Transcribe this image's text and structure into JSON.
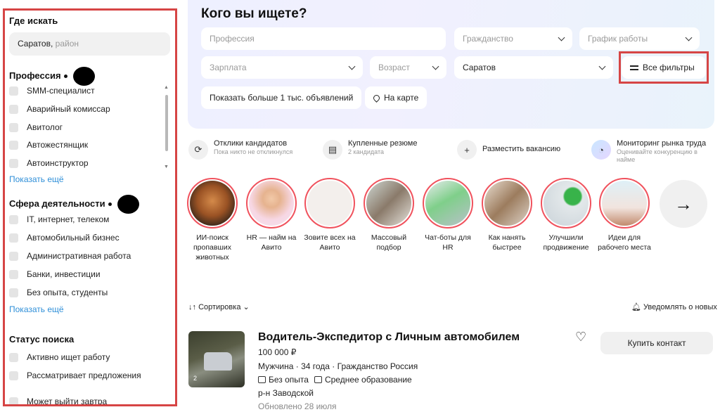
{
  "sidebar": {
    "where_heading": "Где искать",
    "location_value": "Саратов,",
    "location_placeholder": " район",
    "profession_heading": "Профессия",
    "professions": [
      "SMM-специалист",
      "Аварийный комиссар",
      "Авитолог",
      "Автожестянщик",
      "Автоинструктор"
    ],
    "show_more_1": "Показать ещё",
    "sphere_heading": "Сфера деятельности",
    "spheres": [
      "IT, интернет, телеком",
      "Автомобильный бизнес",
      "Административная работа",
      "Банки, инвестиции",
      "Без опыта, студенты"
    ],
    "show_more_2": "Показать ещё",
    "status_heading": "Статус поиска",
    "statuses": [
      "Активно ищет работу",
      "Рассматривает предложения",
      "Может выйти завтра"
    ]
  },
  "search": {
    "title": "Кого вы ищете?",
    "profession_placeholder": "Профессия",
    "citizenship_placeholder": "Гражданство",
    "schedule_placeholder": "График работы",
    "salary_placeholder": "Зарплата",
    "age_placeholder": "Возраст",
    "city_value": "Саратов",
    "all_filters": "Все фильтры",
    "show_more_ads": "Показать больше 1 тыс. объявлений",
    "on_map": "На карте"
  },
  "quick_actions": [
    {
      "title": "Отклики кандидатов",
      "subtitle": "Пока никто не откликнулся",
      "icon": "refresh-icon"
    },
    {
      "title": "Купленные резюме",
      "subtitle": "2 кандидата",
      "icon": "document-icon"
    },
    {
      "title": "Разместить вакансию",
      "subtitle": "",
      "icon": "plus-icon"
    },
    {
      "title": "Мониторинг рынка труда",
      "subtitle": "Оценивайте конкуренцию в найме",
      "icon": "chart-icon"
    }
  ],
  "stories": [
    {
      "label": "ИИ-поиск пропавших животных"
    },
    {
      "label": "HR — найм на Авито"
    },
    {
      "label": "Зовите всех на Авито"
    },
    {
      "label": "Массовый подбор"
    },
    {
      "label": "Чат-боты для HR"
    },
    {
      "label": "Как нанять быстрее"
    },
    {
      "label": "Улучшили продвижение"
    },
    {
      "label": "Идеи для рабочего места"
    }
  ],
  "sort": {
    "label": "Сортировка",
    "notify": "Уведомлять о новых"
  },
  "listing": {
    "title": "Водитель-Экспедитор с Личным автомобилем",
    "price": "100 000 ₽",
    "meta": "Мужчина · 34 года · Гражданство Россия",
    "experience": "Без опыта",
    "education": "Среднее образование",
    "area": "р-н Заводской",
    "updated": "Обновлено 28 июля",
    "photo_count": "2",
    "buy_contact": "Купить контакт"
  },
  "colors": {
    "accent_red": "#d64545",
    "link_blue": "#2f8fd8",
    "story_ring": "#f0525d"
  }
}
